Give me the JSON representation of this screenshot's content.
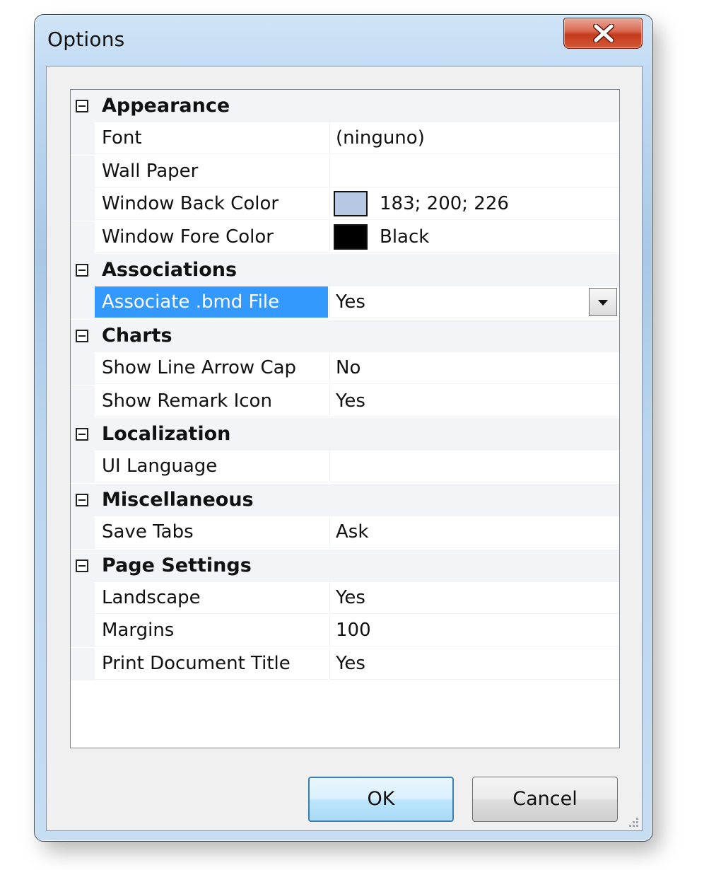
{
  "window": {
    "title": "Options"
  },
  "grid": {
    "categories": [
      {
        "label": "Appearance",
        "properties": [
          {
            "name": "Font",
            "value": "(ninguno)"
          },
          {
            "name": "Wall Paper",
            "value": ""
          },
          {
            "name": "Window Back Color",
            "value": "183; 200; 226",
            "swatch": "#b7c8e2"
          },
          {
            "name": "Window Fore Color",
            "value": "Black",
            "swatch": "#000000"
          }
        ]
      },
      {
        "label": "Associations",
        "properties": [
          {
            "name": "Associate .bmd File",
            "value": "Yes",
            "selected": true
          }
        ]
      },
      {
        "label": "Charts",
        "properties": [
          {
            "name": "Show Line Arrow Cap",
            "value": "No"
          },
          {
            "name": "Show Remark Icon",
            "value": "Yes"
          }
        ]
      },
      {
        "label": "Localization",
        "properties": [
          {
            "name": "UI Language",
            "value": ""
          }
        ]
      },
      {
        "label": "Miscellaneous",
        "properties": [
          {
            "name": "Save Tabs",
            "value": "Ask"
          }
        ]
      },
      {
        "label": "Page Settings",
        "properties": [
          {
            "name": "Landscape",
            "value": "Yes"
          },
          {
            "name": "Margins",
            "value": "100"
          },
          {
            "name": "Print Document Title",
            "value": "Yes"
          }
        ]
      }
    ]
  },
  "buttons": {
    "ok_label": "OK",
    "cancel_label": "Cancel"
  },
  "colors": {
    "selection": "#3399ff",
    "category_bg": "#f2f4f8"
  }
}
